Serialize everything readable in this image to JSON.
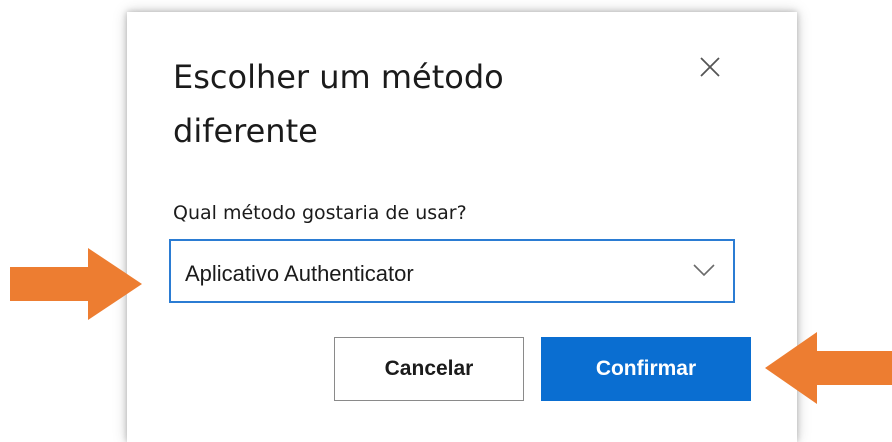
{
  "dialog": {
    "title": "Escolher um método diferente",
    "question_label": "Qual método gostaria de usar?",
    "method_select": {
      "selected_value": "Aplicativo Authenticator"
    },
    "cancel_label": "Cancelar",
    "confirm_label": "Confirmar"
  },
  "icons": {
    "close": "close-icon",
    "dropdown": "chevron-down-icon",
    "annotation": "arrow-icon"
  },
  "colors": {
    "accent_blue": "#0a6ed1",
    "select_border": "#2b7cd3",
    "annotation_orange": "#ed7d31",
    "text": "#1b1b1b"
  }
}
